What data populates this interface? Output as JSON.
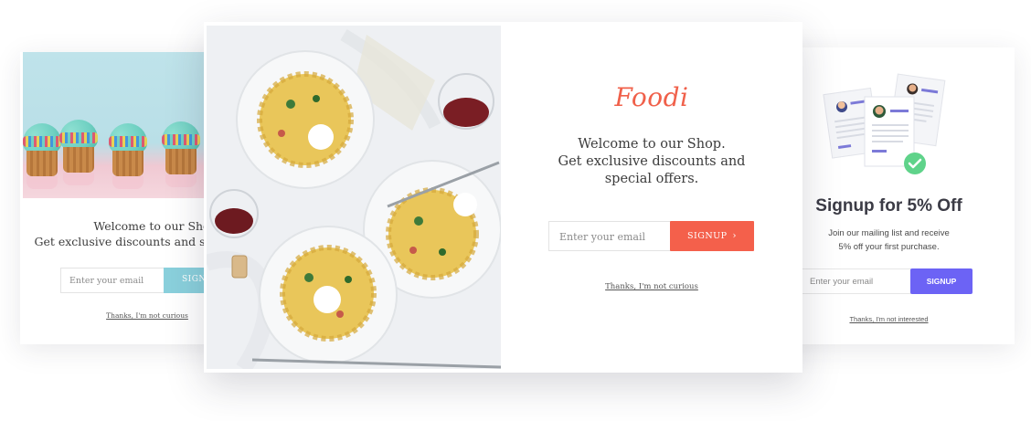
{
  "left_popup": {
    "welcome_line1": "Welcome to our Shop.",
    "welcome_line2": "Get exclusive discounts and special offers.",
    "email_placeholder": "Enter your email",
    "signup_label": "SIGNUP",
    "decline_label": "Thanks, I'm not curious",
    "accent_color": "#8ad0dc"
  },
  "center_popup": {
    "brand": "Foodi",
    "welcome_line1": "Welcome to our Shop.",
    "welcome_line2": "Get exclusive discounts and",
    "welcome_line3": "special offers.",
    "email_placeholder": "Enter your email",
    "signup_label": "SIGNUP",
    "signup_icon": "chevron-right-icon",
    "decline_label": "Thanks, I'm not curious",
    "accent_color": "#f4604b"
  },
  "right_popup": {
    "title": "Signup for 5% Off",
    "desc_line1": "Join our mailing list and receive",
    "desc_line2": "5% off your first purchase.",
    "email_placeholder": "Enter your email",
    "signup_label": "SIGNUP",
    "decline_label": "Thanks, I'm not interested",
    "accent_color": "#6c63f5",
    "illustration_icon": "documents-checkmark-icon"
  }
}
